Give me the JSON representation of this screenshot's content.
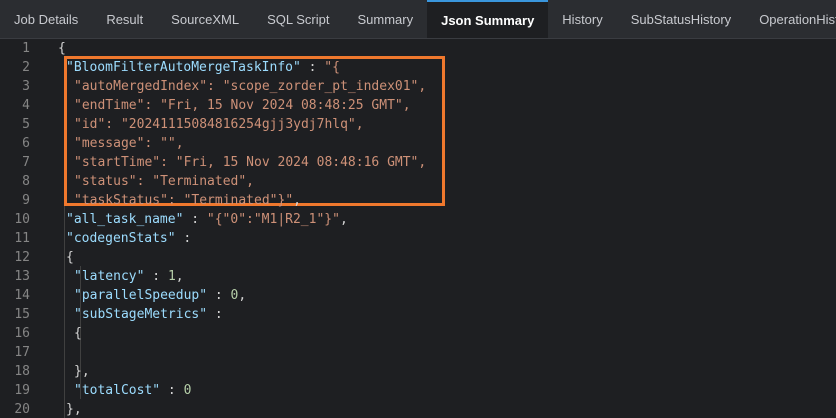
{
  "tabs": [
    {
      "label": "Job Details",
      "active": false
    },
    {
      "label": "Result",
      "active": false
    },
    {
      "label": "SourceXML",
      "active": false
    },
    {
      "label": "SQL Script",
      "active": false
    },
    {
      "label": "Summary",
      "active": false
    },
    {
      "label": "Json Summary",
      "active": true
    },
    {
      "label": "History",
      "active": false
    },
    {
      "label": "SubStatusHistory",
      "active": false
    },
    {
      "label": "OperationHistory",
      "active": false
    }
  ],
  "colors": {
    "accent": "#3a96dd",
    "highlight_border": "#f0782d",
    "key": "#9cdcfe",
    "string": "#ce9178",
    "number": "#b5cea8"
  },
  "editor": {
    "lines": [
      {
        "n": "1",
        "indent": 0,
        "tokens": [
          {
            "t": "p",
            "v": "{"
          }
        ]
      },
      {
        "n": "2",
        "indent": 1,
        "tokens": [
          {
            "t": "k",
            "v": "\"BloomFilterAutoMergeTaskInfo\""
          },
          {
            "t": "p",
            "v": " : "
          },
          {
            "t": "s",
            "v": "\"{"
          }
        ]
      },
      {
        "n": "3",
        "indent": 2,
        "tokens": [
          {
            "t": "s",
            "v": "\"autoMergedIndex\": \"scope_zorder_pt_index01\","
          }
        ]
      },
      {
        "n": "4",
        "indent": 2,
        "tokens": [
          {
            "t": "s",
            "v": "\"endTime\": \"Fri, 15 Nov 2024 08:48:25 GMT\","
          }
        ]
      },
      {
        "n": "5",
        "indent": 2,
        "tokens": [
          {
            "t": "s",
            "v": "\"id\": \"20241115084816254gjj3ydj7hlq\","
          }
        ]
      },
      {
        "n": "6",
        "indent": 2,
        "tokens": [
          {
            "t": "s",
            "v": "\"message\": \"\","
          }
        ]
      },
      {
        "n": "7",
        "indent": 2,
        "tokens": [
          {
            "t": "s",
            "v": "\"startTime\": \"Fri, 15 Nov 2024 08:48:16 GMT\","
          }
        ]
      },
      {
        "n": "8",
        "indent": 2,
        "tokens": [
          {
            "t": "s",
            "v": "\"status\": \"Terminated\","
          }
        ]
      },
      {
        "n": "9",
        "indent": 2,
        "tokens": [
          {
            "t": "s",
            "v": "\"taskStatus\": \"Terminated\"}\""
          },
          {
            "t": "p",
            "v": ","
          }
        ]
      },
      {
        "n": "10",
        "indent": 1,
        "tokens": [
          {
            "t": "k",
            "v": "\"all_task_name\""
          },
          {
            "t": "p",
            "v": " : "
          },
          {
            "t": "s",
            "v": "\"{\"0\":\"M1|R2_1\"}\""
          },
          {
            "t": "p",
            "v": ","
          }
        ]
      },
      {
        "n": "11",
        "indent": 1,
        "tokens": [
          {
            "t": "k",
            "v": "\"codegenStats\""
          },
          {
            "t": "p",
            "v": " :"
          }
        ]
      },
      {
        "n": "12",
        "indent": 1,
        "tokens": [
          {
            "t": "p",
            "v": "{"
          }
        ]
      },
      {
        "n": "13",
        "indent": 2,
        "tokens": [
          {
            "t": "k",
            "v": "\"latency\""
          },
          {
            "t": "p",
            "v": " : "
          },
          {
            "t": "n",
            "v": "1"
          },
          {
            "t": "p",
            "v": ","
          }
        ]
      },
      {
        "n": "14",
        "indent": 2,
        "tokens": [
          {
            "t": "k",
            "v": "\"parallelSpeedup\""
          },
          {
            "t": "p",
            "v": " : "
          },
          {
            "t": "n",
            "v": "0"
          },
          {
            "t": "p",
            "v": ","
          }
        ]
      },
      {
        "n": "15",
        "indent": 2,
        "tokens": [
          {
            "t": "k",
            "v": "\"subStageMetrics\""
          },
          {
            "t": "p",
            "v": " :"
          }
        ]
      },
      {
        "n": "16",
        "indent": 2,
        "tokens": [
          {
            "t": "p",
            "v": "{"
          }
        ]
      },
      {
        "n": "17",
        "indent": 2,
        "tokens": []
      },
      {
        "n": "18",
        "indent": 2,
        "tokens": [
          {
            "t": "p",
            "v": "},"
          }
        ]
      },
      {
        "n": "19",
        "indent": 2,
        "tokens": [
          {
            "t": "k",
            "v": "\"totalCost\""
          },
          {
            "t": "p",
            "v": " : "
          },
          {
            "t": "n",
            "v": "0"
          }
        ]
      },
      {
        "n": "20",
        "indent": 1,
        "tokens": [
          {
            "t": "p",
            "v": "},"
          }
        ]
      }
    ]
  }
}
